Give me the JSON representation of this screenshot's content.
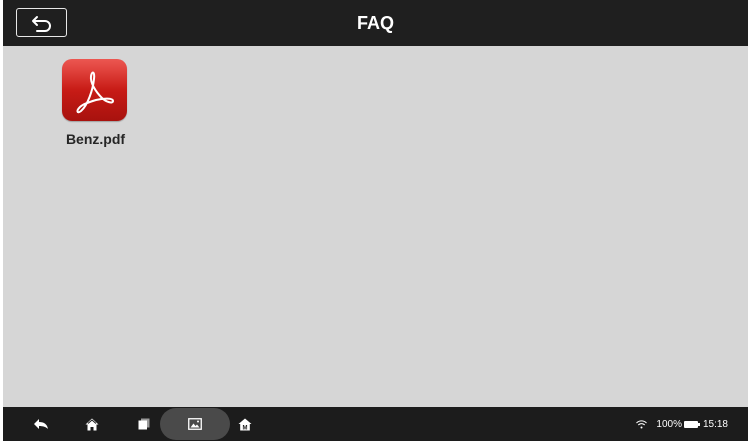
{
  "header": {
    "title": "FAQ",
    "back_icon": "back-arrow-icon"
  },
  "files": [
    {
      "name": "Benz.pdf",
      "icon": "pdf-file-icon"
    }
  ],
  "navbar": {
    "buttons": [
      "back-icon",
      "home-icon",
      "recent-apps-icon",
      "gallery-icon",
      "m-home-icon"
    ]
  },
  "status": {
    "battery": "100%",
    "time": "15:18",
    "wifi_icon": "wifi-icon",
    "battery_icon": "battery-icon"
  },
  "colors": {
    "header_bg": "#1f1f1f",
    "content_bg": "#d6d6d6",
    "navbar_bg": "#1c1c1c",
    "pdf_red": "#d0221c"
  }
}
